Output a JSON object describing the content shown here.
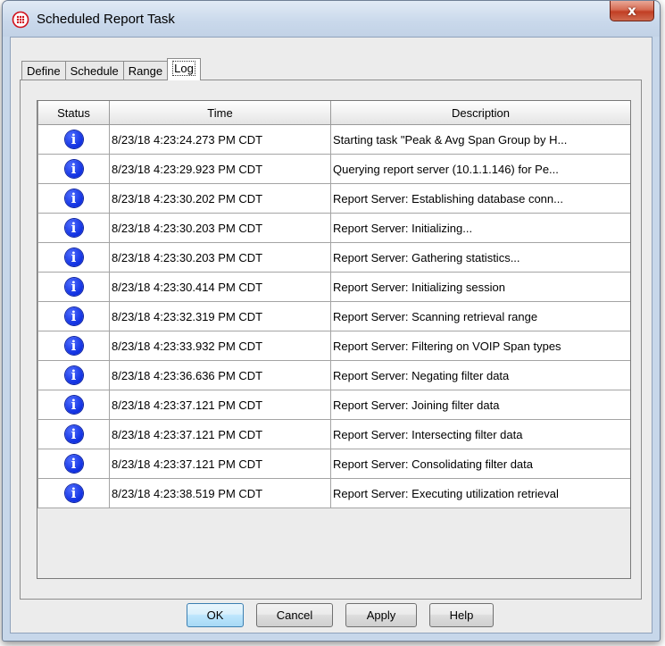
{
  "window": {
    "title": "Scheduled Report Task",
    "close_label": "x"
  },
  "tabs": [
    {
      "label": "Define"
    },
    {
      "label": "Schedule"
    },
    {
      "label": "Range"
    },
    {
      "label": "Log",
      "active": true
    }
  ],
  "table": {
    "headers": {
      "status": "Status",
      "time": "Time",
      "description": "Description"
    },
    "rows": [
      {
        "status_icon": "info-icon",
        "time": "8/23/18 4:23:24.273 PM CDT",
        "description": "Starting task \"Peak & Avg Span Group by H..."
      },
      {
        "status_icon": "info-icon",
        "time": "8/23/18 4:23:29.923 PM CDT",
        "description": "Querying report server (10.1.1.146) for Pe..."
      },
      {
        "status_icon": "info-icon",
        "time": "8/23/18 4:23:30.202 PM CDT",
        "description": "Report Server: Establishing database conn..."
      },
      {
        "status_icon": "info-icon",
        "time": "8/23/18 4:23:30.203 PM CDT",
        "description": "Report Server: Initializing..."
      },
      {
        "status_icon": "info-icon",
        "time": "8/23/18 4:23:30.203 PM CDT",
        "description": "Report Server: Gathering statistics..."
      },
      {
        "status_icon": "info-icon",
        "time": "8/23/18 4:23:30.414 PM CDT",
        "description": "Report Server: Initializing session"
      },
      {
        "status_icon": "info-icon",
        "time": "8/23/18 4:23:32.319 PM CDT",
        "description": "Report Server: Scanning retrieval range"
      },
      {
        "status_icon": "info-icon",
        "time": "8/23/18 4:23:33.932 PM CDT",
        "description": "Report Server: Filtering on VOIP Span types"
      },
      {
        "status_icon": "info-icon",
        "time": "8/23/18 4:23:36.636 PM CDT",
        "description": "Report Server: Negating filter data"
      },
      {
        "status_icon": "info-icon",
        "time": "8/23/18 4:23:37.121 PM CDT",
        "description": "Report Server: Joining filter data"
      },
      {
        "status_icon": "info-icon",
        "time": "8/23/18 4:23:37.121 PM CDT",
        "description": "Report Server: Intersecting filter data"
      },
      {
        "status_icon": "info-icon",
        "time": "8/23/18 4:23:37.121 PM CDT",
        "description": "Report Server: Consolidating filter data"
      },
      {
        "status_icon": "info-icon",
        "time": "8/23/18 4:23:38.519 PM CDT",
        "description": "Report Server: Executing utilization retrieval"
      }
    ]
  },
  "buttons": {
    "ok": "OK",
    "cancel": "Cancel",
    "apply": "Apply",
    "help": "Help"
  },
  "colors": {
    "info_icon": "#1030e0",
    "close_button": "#c13e24",
    "default_button_border": "#3c7fb1"
  }
}
